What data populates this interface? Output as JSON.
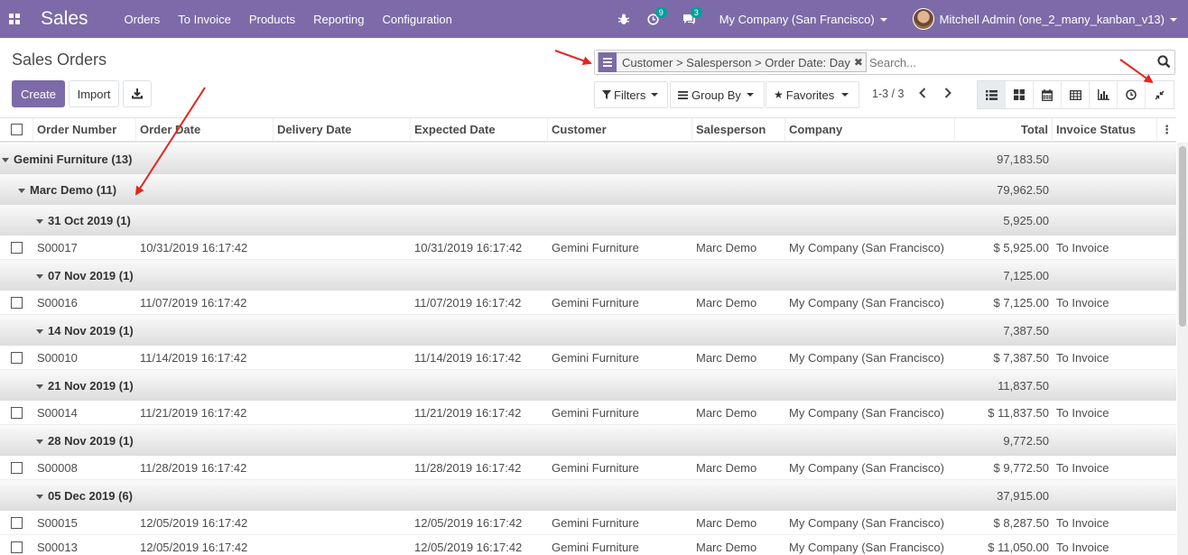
{
  "navbar": {
    "brand": "Sales",
    "menu": [
      "Orders",
      "To Invoice",
      "Products",
      "Reporting",
      "Configuration"
    ],
    "activity_count": "9",
    "messages_count": "3",
    "company": "My Company (San Francisco)",
    "user": "Mitchell Admin (one_2_many_kanban_v13)"
  },
  "control": {
    "title": "Sales Orders",
    "create_label": "Create",
    "import_label": "Import",
    "facet_text": "Customer > Salesperson > Order Date: Day",
    "search_placeholder": "Search...",
    "filters_label": "Filters",
    "groupby_label": "Group By",
    "favorites_label": "Favorites",
    "pager": "1-3 / 3"
  },
  "table": {
    "columns": [
      "Order Number",
      "Order Date",
      "Delivery Date",
      "Expected Date",
      "Customer",
      "Salesperson",
      "Company",
      "Total",
      "Invoice Status"
    ],
    "groups": {
      "customer": {
        "label": "Gemini Furniture (13)",
        "total": "97,183.50"
      },
      "salesperson": {
        "label": "Marc Demo (11)",
        "total": "79,962.50"
      }
    },
    "day_groups": [
      {
        "label": "31 Oct 2019 (1)",
        "total": "5,925.00"
      },
      {
        "label": "07 Nov 2019 (1)",
        "total": "7,125.00"
      },
      {
        "label": "14 Nov 2019 (1)",
        "total": "7,387.50"
      },
      {
        "label": "21 Nov 2019 (1)",
        "total": "11,837.50"
      },
      {
        "label": "28 Nov 2019 (1)",
        "total": "9,772.50"
      },
      {
        "label": "05 Dec 2019 (6)",
        "total": "37,915.00"
      }
    ],
    "records": [
      {
        "number": "S00017",
        "order_date": "10/31/2019 16:17:42",
        "expected_date": "10/31/2019 16:17:42",
        "customer": "Gemini Furniture",
        "salesperson": "Marc Demo",
        "company": "My Company (San Francisco)",
        "total": "$ 5,925.00",
        "status": "To Invoice"
      },
      {
        "number": "S00016",
        "order_date": "11/07/2019 16:17:42",
        "expected_date": "11/07/2019 16:17:42",
        "customer": "Gemini Furniture",
        "salesperson": "Marc Demo",
        "company": "My Company (San Francisco)",
        "total": "$ 7,125.00",
        "status": "To Invoice"
      },
      {
        "number": "S00010",
        "order_date": "11/14/2019 16:17:42",
        "expected_date": "11/14/2019 16:17:42",
        "customer": "Gemini Furniture",
        "salesperson": "Marc Demo",
        "company": "My Company (San Francisco)",
        "total": "$ 7,387.50",
        "status": "To Invoice"
      },
      {
        "number": "S00014",
        "order_date": "11/21/2019 16:17:42",
        "expected_date": "11/21/2019 16:17:42",
        "customer": "Gemini Furniture",
        "salesperson": "Marc Demo",
        "company": "My Company (San Francisco)",
        "total": "$ 11,837.50",
        "status": "To Invoice"
      },
      {
        "number": "S00008",
        "order_date": "11/28/2019 16:17:42",
        "expected_date": "11/28/2019 16:17:42",
        "customer": "Gemini Furniture",
        "salesperson": "Marc Demo",
        "company": "My Company (San Francisco)",
        "total": "$ 9,772.50",
        "status": "To Invoice"
      },
      {
        "number": "S00015",
        "order_date": "12/05/2019 16:17:42",
        "expected_date": "12/05/2019 16:17:42",
        "customer": "Gemini Furniture",
        "salesperson": "Marc Demo",
        "company": "My Company (San Francisco)",
        "total": "$ 8,287.50",
        "status": "To Invoice"
      },
      {
        "number": "S00013",
        "order_date": "12/05/2019 16:17:42",
        "expected_date": "12/05/2019 16:17:42",
        "customer": "Gemini Furniture",
        "salesperson": "Marc Demo",
        "company": "My Company (San Francisco)",
        "total": "$ 11,050.00",
        "status": "To Invoice"
      }
    ]
  },
  "colors": {
    "brand": "#7c6ba8",
    "badge": "#00a09d",
    "annotation_arrow": "#e8231d"
  },
  "icons": [
    "apps-grid-icon",
    "bug-icon",
    "activity-clock-icon",
    "chat-icon",
    "search-icon",
    "download-icon",
    "list-view-icon",
    "kanban-view-icon",
    "calendar-view-icon",
    "pivot-view-icon",
    "graph-view-icon",
    "activity-view-icon",
    "collapse-icon",
    "star-icon",
    "filter-icon",
    "groupby-icon"
  ]
}
